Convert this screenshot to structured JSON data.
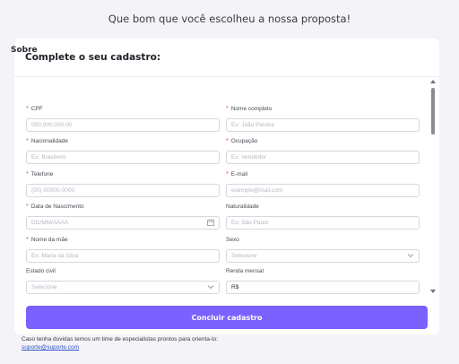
{
  "headline": "Que bom que você escolheu a nossa proposta!",
  "card": {
    "title": "Complete o seu cadastro:",
    "section_title": "Sobre"
  },
  "fields": {
    "cpf": {
      "label": "CPF",
      "required": true,
      "placeholder": "000.000.000-00",
      "value": ""
    },
    "nome": {
      "label": "Nome completo",
      "required": true,
      "placeholder": "Ex: João Pereira",
      "value": ""
    },
    "nacionalidade": {
      "label": "Nacionalidade",
      "required": true,
      "placeholder": "Ex: Brasileiro",
      "value": ""
    },
    "ocupacao": {
      "label": "Ocupação",
      "required": true,
      "placeholder": "Ex: Vendedor",
      "value": ""
    },
    "telefone": {
      "label": "Telefone",
      "required": true,
      "placeholder": "(00) 00000-0000",
      "value": ""
    },
    "email": {
      "label": "E-mail",
      "required": true,
      "placeholder": "exemplo@mail.com",
      "value": ""
    },
    "nascimento": {
      "label": "Data de Nascimento",
      "required": true,
      "placeholder": "DD/MM/AAAA",
      "value": ""
    },
    "naturalidade": {
      "label": "Naturalidade",
      "required": false,
      "placeholder": "Ex: São Paulo",
      "value": ""
    },
    "mae": {
      "label": "Nome da mãe",
      "required": true,
      "placeholder": "Ex: Maria da Silva",
      "value": ""
    },
    "sexo": {
      "label": "Sexo",
      "required": false,
      "placeholder": "Selecione",
      "value": ""
    },
    "estado_civil": {
      "label": "Estado civil",
      "required": false,
      "placeholder": "Selecione",
      "value": ""
    },
    "renda": {
      "label": "Renda mensal",
      "required": false,
      "placeholder": "",
      "value": "R$"
    }
  },
  "required_mark": "*",
  "submit_label": "Concluir cadastro",
  "footer": {
    "text": "Caso tenha duvidas temos um time de especialistas prontos para orienta-lo:",
    "link": "suporte@suporte.com"
  },
  "icons": {
    "calendar": "calendar-icon",
    "chevron": "chevron-down-icon",
    "scroll_up": "scroll-up-arrow-icon",
    "scroll_down": "scroll-down-arrow-icon"
  },
  "colors": {
    "accent": "#7b61ff",
    "required": "#e0475b",
    "link": "#2f56c9",
    "background": "#f4f3f7"
  }
}
